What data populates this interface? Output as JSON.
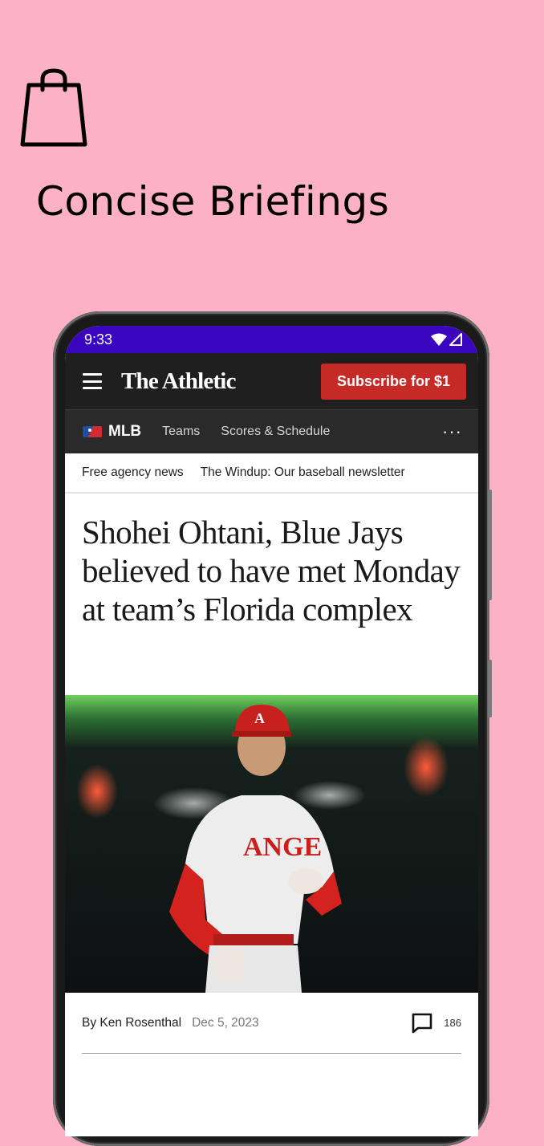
{
  "promo": {
    "icon": "shopping-bag-icon",
    "title": "Concise Briefings"
  },
  "status_bar": {
    "time": "9:33",
    "icons": [
      "wifi-icon",
      "cell-signal-icon"
    ]
  },
  "app_bar": {
    "brand": "The Athletic",
    "subscribe_label": "Subscribe for $1",
    "subscribe_color": "#c62a26"
  },
  "sub_nav": {
    "league": "MLB",
    "links": [
      "Teams",
      "Scores & Schedule"
    ],
    "more_icon": "more-dots-icon"
  },
  "tags": [
    "Free agency news",
    "The Windup: Our baseball newsletter"
  ],
  "article": {
    "headline": "Shohei Ohtani, Blue Jays believed to have met Monday at team’s Florida complex",
    "author": "By Ken Rosenthal",
    "date": "Dec 5, 2023",
    "comment_count": "186"
  },
  "colors": {
    "background": "#fdb1c6",
    "status_bar": "#3a06c0",
    "app_bar": "#1f1f1f"
  }
}
